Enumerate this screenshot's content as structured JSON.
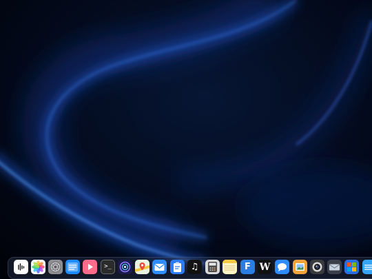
{
  "desktop": {
    "background_color": "#01030a",
    "glow_color": "#1d6cff"
  },
  "dock": {
    "apps": [
      {
        "icon": "voice-memos-icon",
        "glyph": "",
        "bg": "#f2f2f2"
      },
      {
        "icon": "photos-icon",
        "glyph": "",
        "bg": "#ffffff"
      },
      {
        "icon": "system-settings-icon",
        "glyph": "",
        "bg": "#8e8e93"
      },
      {
        "icon": "files-icon",
        "glyph": "",
        "bg": "#1e8cff"
      },
      {
        "icon": "video-player-icon",
        "glyph": "",
        "bg": "#ff6b8a"
      },
      {
        "icon": "terminal-icon",
        "glyph": ">_",
        "bg": "#2b2b2b"
      },
      {
        "icon": "siri-icon",
        "glyph": "",
        "bg": "#1b1b4d"
      },
      {
        "icon": "maps-icon",
        "glyph": "",
        "bg": "#e9f3e2"
      },
      {
        "icon": "mail-icon",
        "glyph": "",
        "bg": "#2f8dff"
      },
      {
        "icon": "clipboard-icon",
        "glyph": "",
        "bg": "#2d7cf7"
      },
      {
        "icon": "music-icon",
        "glyph": "♫",
        "bg": "#121212"
      },
      {
        "icon": "calculator-icon",
        "glyph": "",
        "bg": "#d9d9d9"
      },
      {
        "icon": "notes-icon",
        "glyph": "",
        "bg": "#fff5c2"
      },
      {
        "icon": "font-book-icon",
        "glyph": "F",
        "bg": "#2a7de1"
      },
      {
        "icon": "wikipedia-icon",
        "glyph": "W",
        "bg": "#111111"
      },
      {
        "icon": "messages-icon",
        "glyph": "",
        "bg": "#2e8cff"
      },
      {
        "icon": "preview-icon",
        "glyph": "",
        "bg": "#f0a33b"
      },
      {
        "icon": "camera-icon",
        "glyph": "",
        "bg": "#3a3a3c"
      },
      {
        "icon": "mail-envelope-icon",
        "glyph": "",
        "bg": "#3a3f4a"
      },
      {
        "icon": "windows-app-icon",
        "glyph": "",
        "bg": "#2b6de0"
      },
      {
        "icon": "finder-icon",
        "glyph": "",
        "bg": "#35a4f5"
      }
    ]
  }
}
